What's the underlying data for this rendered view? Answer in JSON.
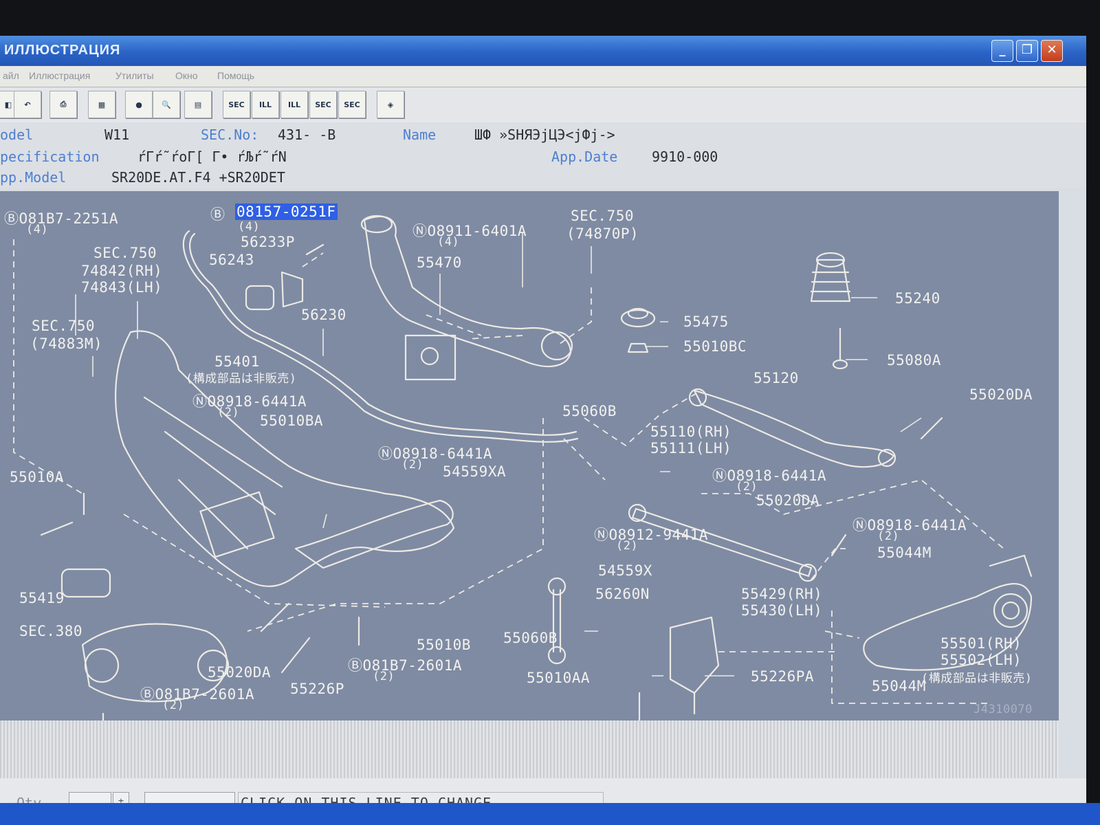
{
  "window": {
    "title": "ИЛЛЮСТРАЦИЯ",
    "minimize": "_",
    "restore": "❐",
    "close": "✕"
  },
  "menu": [
    "айл",
    "Иллюстрация",
    "Утилиты",
    "Окно",
    "Помощь"
  ],
  "toolbar": {
    "buttons": [
      {
        "name": "save-icon",
        "label": "◧"
      },
      {
        "name": "undo-icon",
        "label": "↶"
      },
      {
        "name": "print-icon",
        "label": "⎙"
      },
      {
        "name": "catalog-icon",
        "label": "▦"
      },
      {
        "name": "record-icon",
        "label": "●"
      },
      {
        "name": "magnifier-icon",
        "label": "🔍"
      },
      {
        "name": "notes-icon",
        "label": "▤"
      },
      {
        "name": "sec-prev-icon",
        "label": "SEC"
      },
      {
        "name": "ill-prev-icon",
        "label": "ILL"
      },
      {
        "name": "ill-next-icon",
        "label": "ILL"
      },
      {
        "name": "sec-next-icon",
        "label": "SEC"
      },
      {
        "name": "sec-query-icon",
        "label": "SEC"
      },
      {
        "name": "map-pin-icon",
        "label": "◈"
      }
    ]
  },
  "info": {
    "model_label": "odel",
    "model_value": "W11",
    "sec_label": "SEC.No:",
    "sec_value": "431-   -B",
    "name_label": "Name",
    "name_value": "ШФ »SHЯЭjЦЭ<jФj->",
    "spec_label": "pecification",
    "spec_value": "ŕΓŕ˜ŕoΓ[  Γ•  ŕЉŕ˜ŕN",
    "appdate_label": "App.Date",
    "appdate_value": "9910-000",
    "appmodel_label": "pp.Model",
    "appmodel_value": "SR20DE.AT.F4 +SR20DET"
  },
  "drawing": {
    "labels": [
      "ⒷO81B7-2251A",
      "(4)",
      "Ⓑ",
      "08157-0251F",
      "(4)",
      "56233P",
      "56243",
      "SEC.750",
      "74842(RH)",
      "74843(LH)",
      "ⓃO8911-6401A",
      "(4)",
      "55470",
      "SEC.750",
      "(74870P)",
      "55240",
      "55475",
      "55010BC",
      "55080A",
      "56230",
      "SEC.750",
      "(74883M)",
      "55401",
      "(構成部品は非販売)",
      "ⓃO8918-6441A",
      "(2)",
      "55010BA",
      "55120",
      "55020DA",
      "55060B",
      "55110(RH)",
      "55111(LH)",
      "55010A",
      "ⓃO8918-6441A",
      "(2)",
      "54559XA",
      "ⓃO8918-6441A",
      "(2)",
      "55020DA",
      "ⓃO8912-9441A",
      "(2)",
      "ⓃO8918-6441A",
      "(2)",
      "55044M",
      "54559X",
      "56260N",
      "55429(RH)",
      "55430(LH)",
      "55419",
      "SEC.380",
      "55010B",
      "ⒷO81B7-2601A",
      "(2)",
      "55060B",
      "55020DA",
      "55226P",
      "ⒷO81B7-2601A",
      "(2)",
      "55010AA",
      "55226PA",
      "55501(RH)",
      "55502(LH)",
      "(構成部品は非販売)",
      "55044M",
      "J4310070"
    ]
  },
  "status": {
    "qty_label": "Qty",
    "message": "CLICK ON THIS LINE TO CHANGE"
  }
}
